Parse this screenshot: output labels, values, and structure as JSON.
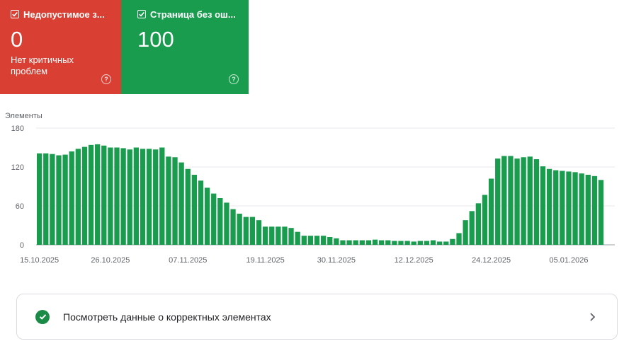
{
  "cards": {
    "invalid": {
      "title": "Недопустимое з...",
      "value": "0",
      "subtitle": "Нет критичных проблем",
      "help": "?",
      "color": "#d93f33"
    },
    "valid": {
      "title": "Страница без ош...",
      "value": "100",
      "help": "?",
      "color": "#1a9c4f"
    }
  },
  "chart_data": {
    "type": "bar",
    "ylabel": "Элементы",
    "ylim": [
      0,
      180
    ],
    "yticks": [
      "0",
      "60",
      "120",
      "180"
    ],
    "xtick_labels": [
      "15.10.2025",
      "26.10.2025",
      "07.11.2025",
      "19.11.2025",
      "30.11.2025",
      "12.12.2025",
      "24.12.2025",
      "05.01.2026"
    ],
    "grid": true,
    "bar_color": "#1a9c4f",
    "values": [
      141,
      141,
      140,
      138,
      139,
      144,
      148,
      151,
      154,
      155,
      153,
      150,
      150,
      149,
      147,
      150,
      148,
      148,
      147,
      150,
      136,
      135,
      127,
      117,
      108,
      99,
      88,
      79,
      72,
      65,
      55,
      48,
      43,
      43,
      38,
      28,
      28,
      28,
      28,
      26,
      20,
      14,
      14,
      14,
      14,
      12,
      10,
      7,
      7,
      7,
      7,
      7,
      8,
      7,
      7,
      6,
      6,
      6,
      5,
      6,
      6,
      7,
      5,
      5,
      9,
      18,
      38,
      52,
      64,
      77,
      102,
      133,
      137,
      137,
      133,
      135,
      136,
      132,
      121,
      117,
      115,
      114,
      113,
      112,
      110,
      108,
      106,
      100
    ]
  },
  "link": {
    "label": "Посмотреть данные о корректных элементах"
  }
}
